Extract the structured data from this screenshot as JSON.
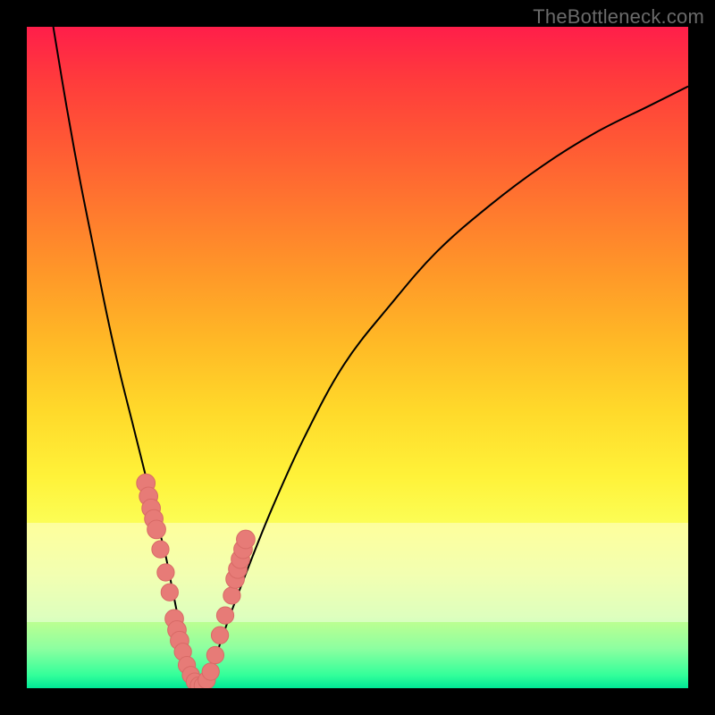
{
  "watermark": "TheBottleneck.com",
  "colors": {
    "frame": "#000000",
    "curve": "#000000",
    "marker_fill": "#e77b77",
    "marker_stroke": "#d86a66"
  },
  "chart_data": {
    "type": "line",
    "title": "",
    "xlabel": "",
    "ylabel": "",
    "xlim": [
      0,
      100
    ],
    "ylim": [
      0,
      100
    ],
    "grid": false,
    "legend": false,
    "series": [
      {
        "name": "bottleneck-curve",
        "x": [
          4,
          6,
          8,
          10,
          12,
          14,
          16,
          18,
          19,
          20,
          21,
          22,
          23,
          24,
          25,
          26,
          27,
          28,
          30,
          33,
          37,
          42,
          48,
          55,
          62,
          70,
          78,
          86,
          94,
          100
        ],
        "y": [
          100,
          88,
          77,
          67,
          57,
          48,
          40,
          32,
          28,
          24,
          20,
          15,
          10,
          5,
          2,
          0,
          0,
          3,
          9,
          17,
          27,
          38,
          49,
          58,
          66,
          73,
          79,
          84,
          88,
          91
        ]
      }
    ],
    "markers": [
      {
        "x": 18.0,
        "y": 31.0,
        "r": 1.4
      },
      {
        "x": 18.4,
        "y": 29.0,
        "r": 1.4
      },
      {
        "x": 18.8,
        "y": 27.2,
        "r": 1.4
      },
      {
        "x": 19.2,
        "y": 25.6,
        "r": 1.4
      },
      {
        "x": 19.6,
        "y": 24.0,
        "r": 1.4
      },
      {
        "x": 20.2,
        "y": 21.0,
        "r": 1.3
      },
      {
        "x": 21.0,
        "y": 17.5,
        "r": 1.3
      },
      {
        "x": 21.6,
        "y": 14.5,
        "r": 1.3
      },
      {
        "x": 22.3,
        "y": 10.5,
        "r": 1.4
      },
      {
        "x": 22.7,
        "y": 8.8,
        "r": 1.4
      },
      {
        "x": 23.1,
        "y": 7.2,
        "r": 1.4
      },
      {
        "x": 23.6,
        "y": 5.5,
        "r": 1.3
      },
      {
        "x": 24.2,
        "y": 3.5,
        "r": 1.3
      },
      {
        "x": 24.8,
        "y": 2.0,
        "r": 1.3
      },
      {
        "x": 25.4,
        "y": 1.0,
        "r": 1.3
      },
      {
        "x": 26.0,
        "y": 0.4,
        "r": 1.3
      },
      {
        "x": 26.6,
        "y": 0.4,
        "r": 1.3
      },
      {
        "x": 27.2,
        "y": 1.2,
        "r": 1.3
      },
      {
        "x": 27.8,
        "y": 2.5,
        "r": 1.3
      },
      {
        "x": 28.5,
        "y": 5.0,
        "r": 1.3
      },
      {
        "x": 29.2,
        "y": 8.0,
        "r": 1.3
      },
      {
        "x": 30.0,
        "y": 11.0,
        "r": 1.3
      },
      {
        "x": 31.0,
        "y": 14.0,
        "r": 1.3
      },
      {
        "x": 31.5,
        "y": 16.5,
        "r": 1.4
      },
      {
        "x": 31.9,
        "y": 18.0,
        "r": 1.4
      },
      {
        "x": 32.3,
        "y": 19.5,
        "r": 1.4
      },
      {
        "x": 32.7,
        "y": 21.0,
        "r": 1.4
      },
      {
        "x": 33.1,
        "y": 22.5,
        "r": 1.4
      }
    ],
    "pale_band": {
      "y_top": 25,
      "y_bottom": 10
    }
  }
}
